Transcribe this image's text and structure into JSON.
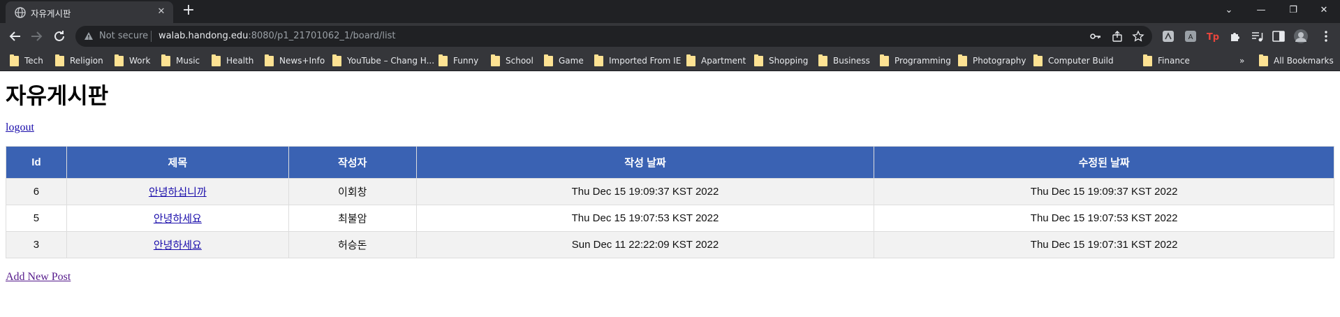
{
  "browser": {
    "tab_title": "자유게시판",
    "secure_text": "Not secure",
    "url_host": "walab.handong.edu",
    "url_rest": ":8080/p1_21701062_1/board/list",
    "bookmarks": [
      "Tech",
      "Religion",
      "Work",
      "Music",
      "Health",
      "News+Info",
      "YouTube – Chang H...",
      "Funny",
      "School",
      "Game",
      "Imported From IE",
      "Apartment",
      "Shopping",
      "Business",
      "Programming",
      "Photography",
      "Computer Build",
      "Finance"
    ],
    "more_bookmarks": "»",
    "all_bookmarks": "All Bookmarks"
  },
  "page": {
    "title": "자유게시판",
    "logout_label": "logout",
    "add_post_label": "Add New Post"
  },
  "table": {
    "headers": [
      "Id",
      "제목",
      "작성자",
      "작성 날짜",
      "수정된 날짜"
    ],
    "rows": [
      {
        "id": "6",
        "title": "안녕하십니까",
        "author": "이회창",
        "created": "Thu Dec 15 19:09:37 KST 2022",
        "modified": "Thu Dec 15 19:09:37 KST 2022"
      },
      {
        "id": "5",
        "title": "안녕하세요",
        "author": "최불암",
        "created": "Thu Dec 15 19:07:53 KST 2022",
        "modified": "Thu Dec 15 19:07:53 KST 2022"
      },
      {
        "id": "3",
        "title": "안녕하세요",
        "author": "허승돈",
        "created": "Sun Dec 11 22:22:09 KST 2022",
        "modified": "Thu Dec 15 19:07:31 KST 2022"
      }
    ]
  },
  "colors": {
    "header_bg": "#3a62b3",
    "row_alt_bg": "#f2f2f2",
    "link": "#1a0dab",
    "visited_link": "#551a8b"
  }
}
